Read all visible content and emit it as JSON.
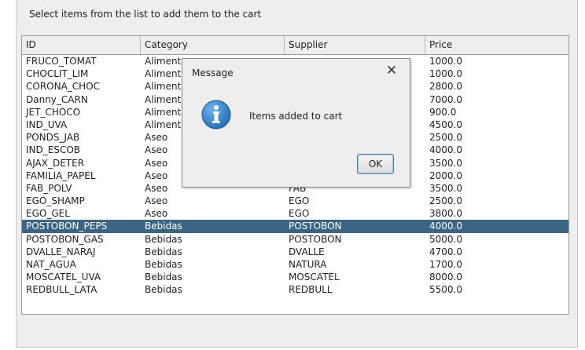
{
  "instruction": "Select items from the list to add them to the cart",
  "table": {
    "columns": [
      "ID",
      "Category",
      "Supplier",
      "Price"
    ],
    "rows": [
      {
        "id": "FRUCO_TOMAT",
        "category": "Aliment",
        "supplier": "",
        "price": "1000.0"
      },
      {
        "id": "CHOCLIT_LIM",
        "category": "Aliment",
        "supplier": "",
        "price": "1000.0"
      },
      {
        "id": "CORONA_CHOC",
        "category": "Aliment",
        "supplier": "",
        "price": "2800.0"
      },
      {
        "id": "Danny_CARN",
        "category": "Aliment",
        "supplier": "",
        "price": "7000.0"
      },
      {
        "id": "JET_CHOCO",
        "category": "Aliment",
        "supplier": "",
        "price": "900.0"
      },
      {
        "id": "IND_UVA",
        "category": "Aliment",
        "supplier": "",
        "price": "4500.0"
      },
      {
        "id": "PONDS_JAB",
        "category": "Aseo",
        "supplier": "",
        "price": "2500.0"
      },
      {
        "id": "IND_ESCOB",
        "category": "Aseo",
        "supplier": "",
        "price": "4000.0"
      },
      {
        "id": "AJAX_DETER",
        "category": "Aseo",
        "supplier": "",
        "price": "3500.0"
      },
      {
        "id": "FAMILIA_PAPEL",
        "category": "Aseo",
        "supplier": "",
        "price": "2000.0"
      },
      {
        "id": "FAB_POLV",
        "category": "Aseo",
        "supplier": "FAB",
        "price": "3500.0"
      },
      {
        "id": "EGO_SHAMP",
        "category": "Aseo",
        "supplier": "EGO",
        "price": "2500.0"
      },
      {
        "id": "EGO_GEL",
        "category": "Aseo",
        "supplier": "EGO",
        "price": "3800.0"
      },
      {
        "id": "POSTOBON_PEPS",
        "category": "Bebidas",
        "supplier": "POSTOBON",
        "price": "4000.0"
      },
      {
        "id": "POSTOBON_GAS",
        "category": "Bebidas",
        "supplier": "POSTOBON",
        "price": "5000.0"
      },
      {
        "id": "DVALLE_NARAJ",
        "category": "Bebidas",
        "supplier": "DVALLE",
        "price": "4700.0"
      },
      {
        "id": "NAT_AGUA",
        "category": "Bebidas",
        "supplier": "NATURA",
        "price": "1700.0"
      },
      {
        "id": "MOSCATEL_UVA",
        "category": "Bebidas",
        "supplier": "MOSCATEL",
        "price": "8000.0"
      },
      {
        "id": "REDBULL_LATA",
        "category": "Bebidas",
        "supplier": "REDBULL",
        "price": "5500.0"
      }
    ],
    "selected_row_id": "POSTOBON_PEPS"
  },
  "dialog": {
    "title": "Message",
    "message": "Items added to cart",
    "ok_label": "OK",
    "close_glyph": "✕",
    "icon": "information-icon"
  },
  "colors": {
    "selection": "#3b6583",
    "info_icon": "#1f6fb8"
  }
}
